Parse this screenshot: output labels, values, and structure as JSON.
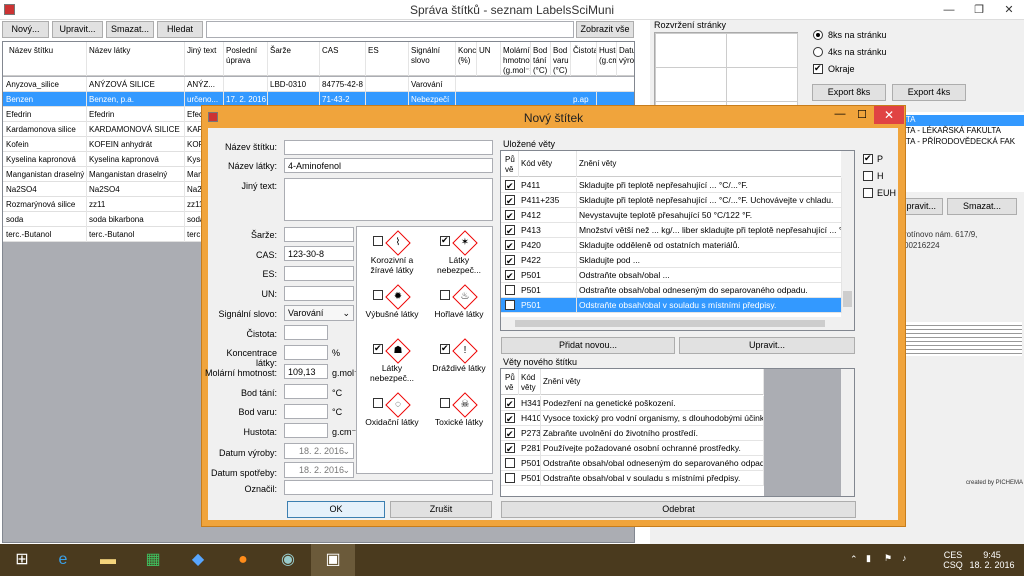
{
  "main": {
    "title": "Správa štítků - seznam LabelsSciMuni",
    "toolbar": {
      "new": "Nový...",
      "edit": "Upravit...",
      "delete": "Smazat...",
      "search": "Hledat",
      "show_all": "Zobrazit vše"
    },
    "columns": [
      "Název štítku",
      "Název látky",
      "Jiný text",
      "Poslední úprava",
      "Šarže",
      "CAS",
      "ES",
      "Signální slovo",
      "Koncentrace (%)",
      "UN",
      "Molární hmotnost (g.mol⁻¹)",
      "Bod tání (°C)",
      "Bod varu (°C)",
      "Čistota",
      "Hustota (g.cm⁻³)",
      "Datum výroby"
    ],
    "rows": [
      [
        "Anyzova_silice",
        "ANÝZOVÁ SILICE",
        "ANÝZ...",
        "",
        "LBD-0310",
        "84775-42-8",
        "",
        "Varování"
      ],
      [
        "Benzen",
        "Benzen, p.a.",
        "určeno...",
        "17. 2. 2016",
        "",
        "71-43-2",
        "",
        "Nebezpečí",
        "p.ap"
      ],
      [
        "Efedrin",
        "Efedrin",
        "Efedr...",
        "",
        "",
        "",
        "",
        "",
        ""
      ],
      [
        "Kardamonova silice",
        "KARDAMONOVÁ SILICE",
        "KARD...",
        "",
        "",
        "",
        "",
        "",
        ""
      ],
      [
        "Kofein",
        "KOFEIN anhydrát",
        "KOFE...",
        "",
        "",
        "",
        "",
        "",
        ""
      ],
      [
        "Kyselina kapronová",
        "Kyselina kapronová",
        "Kyseli...",
        "",
        "",
        "",
        "",
        "",
        ""
      ],
      [
        "Manganistan draselný",
        "Manganistan draselný",
        "Mang...",
        "",
        "",
        "",
        "",
        "",
        ""
      ],
      [
        "Na2SO4",
        "Na2SO4",
        "Na2S...",
        "",
        "",
        "",
        "",
        "",
        ""
      ],
      [
        "Rozmarýnová silice",
        "zz11",
        "zz11",
        "",
        "",
        "",
        "",
        "",
        ""
      ],
      [
        "soda",
        "soda bikarbona",
        "soda...",
        "",
        "",
        "",
        "",
        "",
        ""
      ],
      [
        "terc.-Butanol",
        "terc.-Butanol",
        "terc...",
        "",
        "",
        "",
        "",
        "",
        ""
      ]
    ]
  },
  "right": {
    "preview_label": "Rozvržení stránky",
    "opt8": "8ks na stránku",
    "opt4": "4ks na stránku",
    "border": "Okraje",
    "export8": "Export 8ks",
    "export4": "Export 4ks",
    "edit": "Upravit...",
    "delete": "Smazat...",
    "list": [
      "LTA",
      "LTA - LÉKAŘSKÁ FAKULTA",
      "LTA - PŘÍRODOVĚDECKÁ FAK"
    ],
    "addr1": "rotínovo nám. 617/9,",
    "addr2": "00216224",
    "tiny": "created by PICHEMA"
  },
  "dialog": {
    "title": "Nový štítek",
    "fields": {
      "name_label": "Název štítku:",
      "name": "",
      "subst_label": "Název látky:",
      "subst": "4-Aminofenol",
      "other_label": "Jiný text:",
      "batch_label": "Šarže:",
      "cas_label": "CAS:",
      "cas": "123-30-8",
      "es_label": "ES:",
      "un_label": "UN:",
      "signal_label": "Signální slovo:",
      "signal": "Varování",
      "purity_label": "Čistota:",
      "conc_label": "Koncentrace látky:",
      "conc_unit": "%",
      "molar_label": "Molární hmotnost:",
      "molar": "109,13",
      "molar_unit": "g.mol⁻¹",
      "melt_label": "Bod tání:",
      "melt_unit": "°C",
      "boil_label": "Bod varu:",
      "boil_unit": "°C",
      "dens_label": "Hustota:",
      "dens_unit": "g.cm⁻³",
      "prod_label": "Datum výroby:",
      "prod": "18.  2. 2016",
      "exp_label": "Datum spotřeby:",
      "exp": "18.  2. 2016",
      "mark_label": "Označil:"
    },
    "hazards": [
      {
        "label": "Korozivní a žíravé látky",
        "checked": false,
        "icon": "corrosive-icon"
      },
      {
        "label": "Látky nebezpeč...",
        "checked": true,
        "icon": "health-hazard-icon"
      },
      {
        "label": "Výbušné látky",
        "checked": false,
        "icon": "explosive-icon"
      },
      {
        "label": "Hořlavé látky",
        "checked": false,
        "icon": "flammable-icon"
      },
      {
        "label": "Látky nebezpeč...",
        "checked": true,
        "icon": "serious-health-hazard-icon"
      },
      {
        "label": "Dráždivé látky",
        "checked": true,
        "icon": "exclamation-icon"
      },
      {
        "label": "Oxidační látky",
        "checked": false,
        "icon": "oxidizer-icon"
      },
      {
        "label": "Toxické látky",
        "checked": false,
        "icon": "toxic-icon"
      }
    ],
    "saved_title": "Uložené věty",
    "saved_cols": [
      "Pů vě",
      "Kód věty",
      "Znění věty"
    ],
    "saved": [
      [
        "P411",
        "Skladujte při teplotě nepřesahující ... °C/...°F.",
        true
      ],
      [
        "P411+235",
        "Skladujte při teplotě nepřesahující ... °C/...°F. Uchovávejte v chladu.",
        true
      ],
      [
        "P412",
        "Nevystavujte teplotě přesahující 50 °C/122 °F.",
        true
      ],
      [
        "P413",
        "Množství větší než ... kg/... liber skladujte při teplotě nepřesahující ... °C/...",
        true
      ],
      [
        "P420",
        "Skladujte odděleně od ostatních materiálů.",
        true
      ],
      [
        "P422",
        "Skladujte pod ...",
        true
      ],
      [
        "P501",
        "Odstraňte obsah/obal ...",
        true
      ],
      [
        "P501",
        "Odstraňte obsah/obal odneseným do separovaného odpadu.",
        false
      ],
      [
        "P501",
        "Odstraňte obsah/obal v souladu s místními předpisy.",
        false
      ]
    ],
    "filters": [
      {
        "label": "P",
        "checked": true
      },
      {
        "label": "H",
        "checked": false
      },
      {
        "label": "EUH",
        "checked": false
      }
    ],
    "add_new": "Přidat novou...",
    "edit": "Upravit...",
    "new_title": "Věty nového štítku",
    "new_cols": [
      "Pů vě",
      "Kód věty",
      "Znění věty"
    ],
    "newrows": [
      [
        "H341",
        "Podezření na genetické poškození.",
        true
      ],
      [
        "H410",
        "Vysoce toxický pro vodní organismy, s dlouhodobými účinky.",
        true
      ],
      [
        "P273",
        "Zabraňte uvolnění do životního prostředí.",
        true
      ],
      [
        "P281",
        "Používejte požadované osobní ochranné prostředky.",
        true
      ],
      [
        "P501",
        "Odstraňte obsah/obal odneseným do separovaného odpadu.",
        false
      ],
      [
        "P501",
        "Odstraňte obsah/obal v souladu s místními předpisy.",
        false
      ]
    ],
    "ok": "OK",
    "cancel": "Zrušit",
    "remove": "Odebrat"
  },
  "taskbar": {
    "lang": "CES",
    "lang2": "CSQ",
    "time": "9:45",
    "date": "18. 2. 2016"
  }
}
